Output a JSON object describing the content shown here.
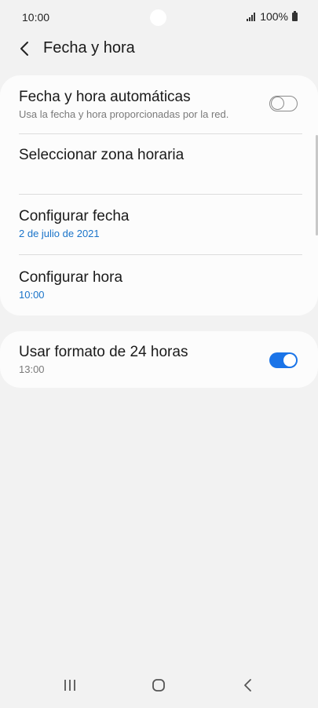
{
  "status_bar": {
    "time": "10:00",
    "battery": "100%"
  },
  "header": {
    "title": "Fecha y hora"
  },
  "settings": {
    "auto_datetime": {
      "title": "Fecha y hora automáticas",
      "subtitle": "Usa la fecha y hora proporcionadas por la red.",
      "enabled": false
    },
    "timezone": {
      "title": "Seleccionar zona horaria"
    },
    "set_date": {
      "title": "Configurar fecha",
      "value": "2 de julio de 2021"
    },
    "set_time": {
      "title": "Configurar hora",
      "value": "10:00"
    },
    "format_24h": {
      "title": "Usar formato de 24 horas",
      "subtitle": "13:00",
      "enabled": true
    }
  },
  "colors": {
    "accent": "#1a74e8",
    "value_text": "#1a74c9",
    "background": "#f2f2f2",
    "card": "#fcfcfc"
  },
  "icons": {
    "back": "chevron-left-icon",
    "signal": "signal-icon",
    "battery": "battery-icon",
    "nav_recents": "recents-icon",
    "nav_home": "home-icon",
    "nav_back": "back-icon"
  }
}
